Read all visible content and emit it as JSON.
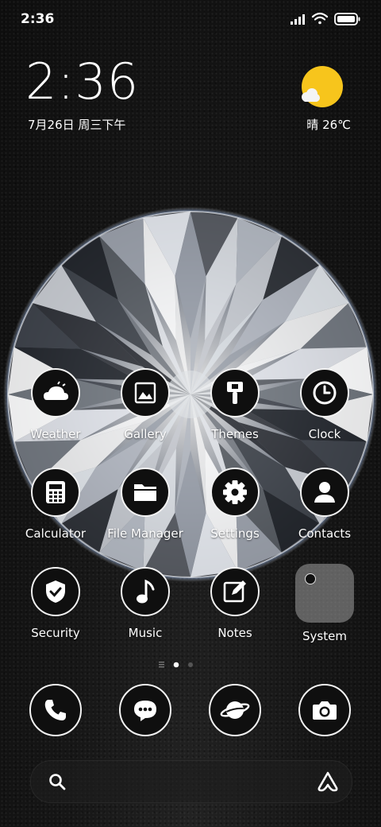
{
  "status_bar": {
    "time": "2:36",
    "signal": "signal-icon",
    "wifi": "wifi-icon",
    "battery": "battery-icon"
  },
  "clock_widget": {
    "time": "2:36",
    "date": "7月26日 周三下午"
  },
  "weather_widget": {
    "text": "晴 26℃",
    "icon": "sunny-partly-cloudy-icon"
  },
  "apps": {
    "row1": [
      {
        "label": "Weather",
        "icon": "weather-icon"
      },
      {
        "label": "Gallery",
        "icon": "gallery-icon"
      },
      {
        "label": "Themes",
        "icon": "paintbrush-icon"
      },
      {
        "label": "Clock",
        "icon": "clock-icon"
      }
    ],
    "row2": [
      {
        "label": "Calculator",
        "icon": "calculator-icon"
      },
      {
        "label": "File Manager",
        "icon": "folder-icon"
      },
      {
        "label": "Settings",
        "icon": "gear-icon"
      },
      {
        "label": "Contacts",
        "icon": "contact-icon"
      }
    ],
    "row3": [
      {
        "label": "Security",
        "icon": "shield-check-icon"
      },
      {
        "label": "Music",
        "icon": "music-note-icon"
      },
      {
        "label": "Notes",
        "icon": "edit-icon"
      },
      {
        "label": "System",
        "icon": "folder-group-icon"
      }
    ]
  },
  "dock": [
    {
      "icon": "phone-icon"
    },
    {
      "icon": "message-icon"
    },
    {
      "icon": "browser-planet-icon"
    },
    {
      "icon": "camera-icon"
    }
  ],
  "search_bar": {
    "left_icon": "search-icon",
    "right_icon": "assistant-icon"
  },
  "colors": {
    "accent_sun": "#f7c51c",
    "icon_bg": "#0f0f0f",
    "icon_border": "#f2f2f2"
  }
}
